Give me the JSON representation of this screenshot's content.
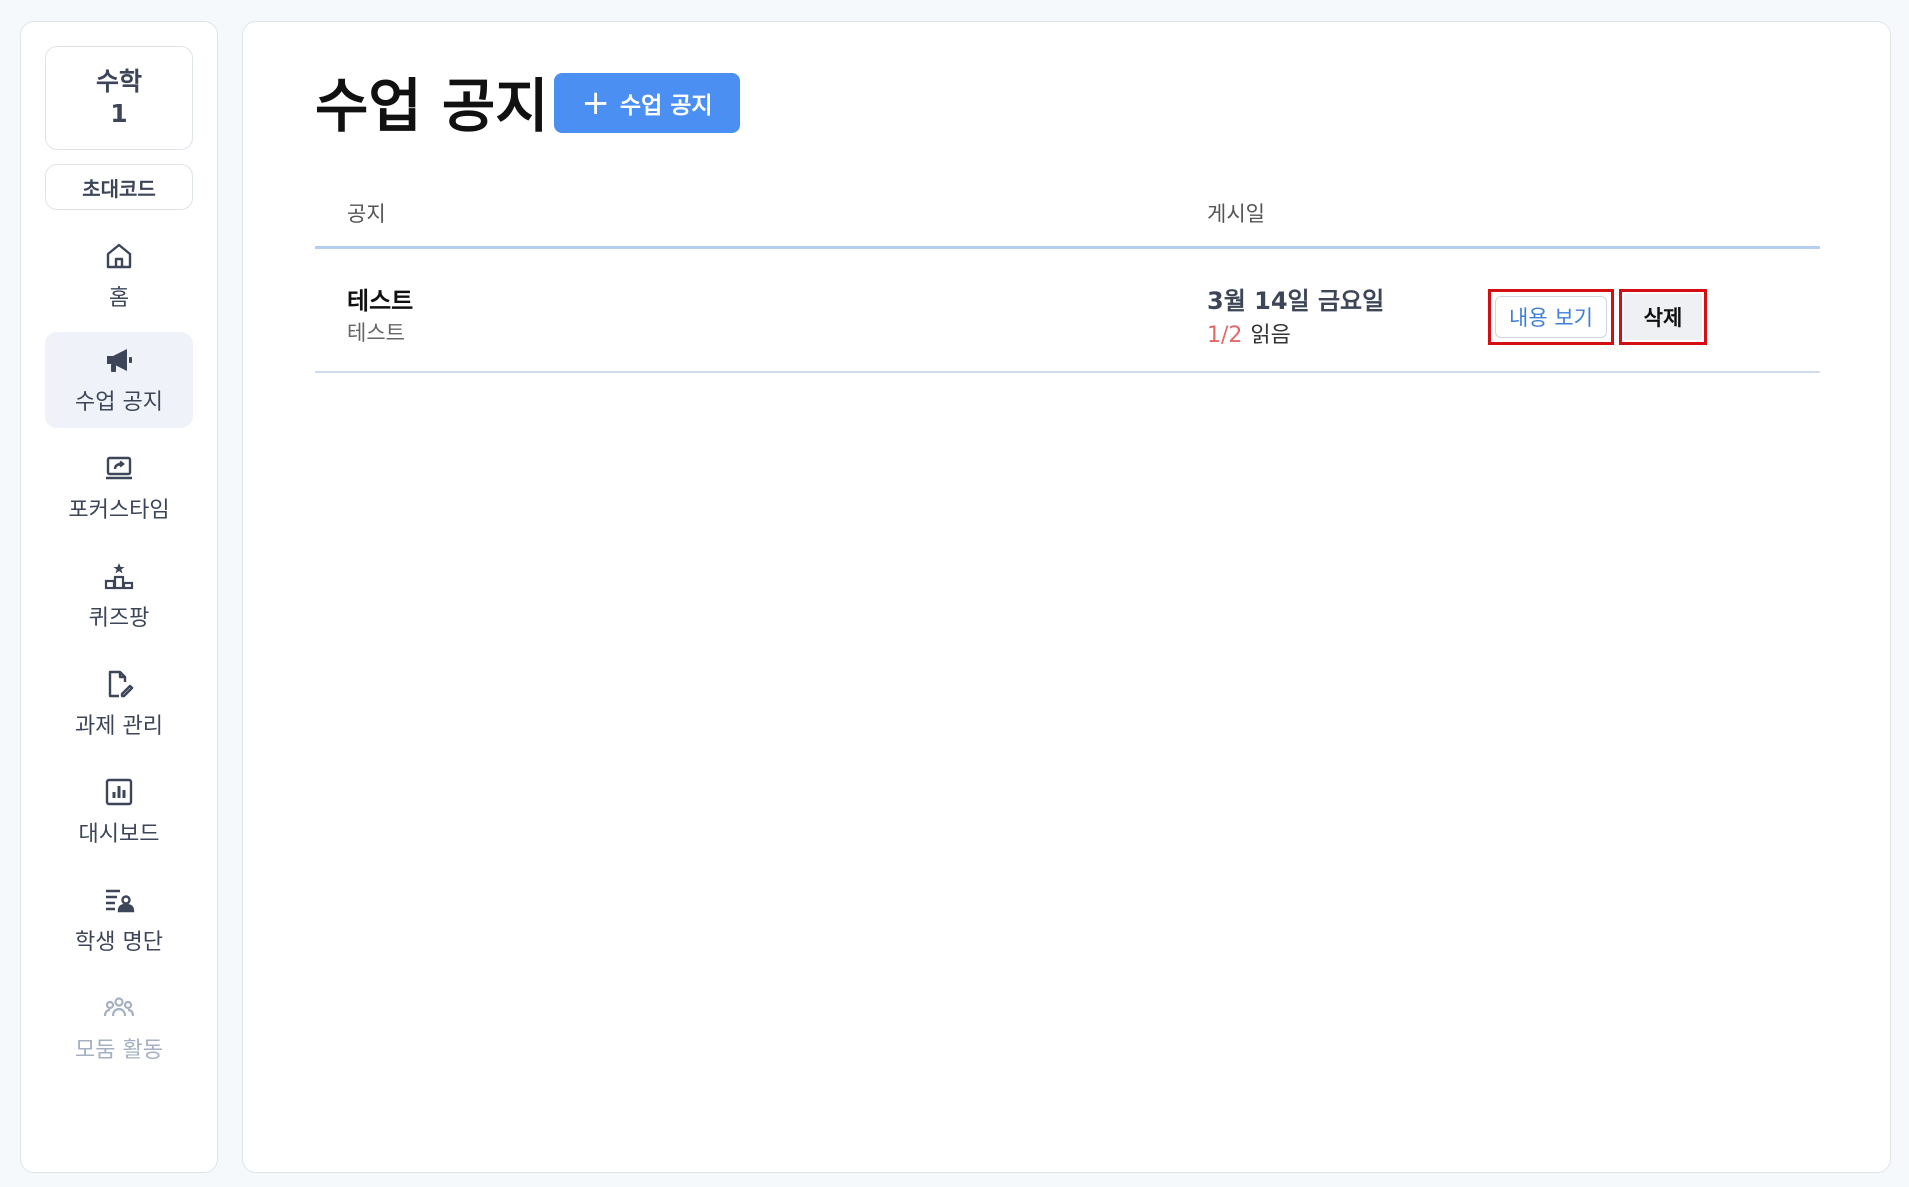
{
  "sidebar": {
    "class_name_line1": "수학",
    "class_name_line2": "1",
    "invite_label": "초대코드",
    "items": [
      {
        "label": "홈",
        "icon": "home-icon"
      },
      {
        "label": "수업 공지",
        "icon": "megaphone-icon",
        "active": true
      },
      {
        "label": "포커스타임",
        "icon": "screen-share-icon"
      },
      {
        "label": "퀴즈팡",
        "icon": "podium-icon"
      },
      {
        "label": "과제 관리",
        "icon": "edit-document-icon"
      },
      {
        "label": "대시보드",
        "icon": "chart-icon"
      },
      {
        "label": "학생 명단",
        "icon": "student-list-icon"
      },
      {
        "label": "모둠 활동",
        "icon": "group-icon",
        "disabled": true
      }
    ]
  },
  "main": {
    "title": "수업 공지",
    "add_button_label": "수업 공지",
    "columns": {
      "notice": "공지",
      "date": "게시일"
    },
    "rows": [
      {
        "title": "테스트",
        "body": "테스트",
        "date": "3월 14일 금요일",
        "read_count": "1/2",
        "read_label": "읽음",
        "view_label": "내용 보기",
        "delete_label": "삭제"
      }
    ]
  },
  "colors": {
    "accent": "#4c8ff2",
    "highlight": "#d40f14",
    "read_count": "#e06a6a"
  }
}
